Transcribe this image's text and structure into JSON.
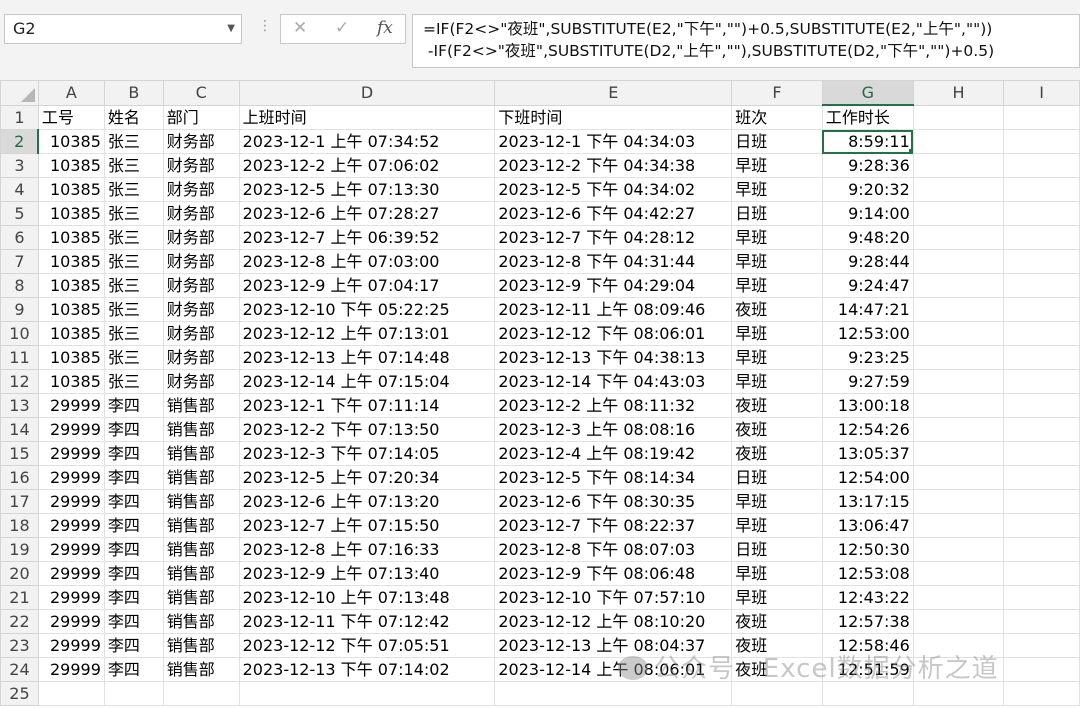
{
  "name_box": "G2",
  "formula_icons": [
    "close-icon",
    "check-icon",
    "fx-icon"
  ],
  "formula": "=IF(F2<>\"夜班\",SUBSTITUTE(E2,\"下午\",\"\")+0.5,SUBSTITUTE(E2,\"上午\",\"\"))\n -IF(F2<>\"夜班\",SUBSTITUTE(D2,\"上午\",\"\"),SUBSTITUTE(D2,\"下午\",\"\")+0.5)",
  "columns": [
    "A",
    "B",
    "C",
    "D",
    "E",
    "F",
    "G",
    "H",
    "I"
  ],
  "header_row": [
    "工号",
    "姓名",
    "部门",
    "上班时间",
    "下班时间",
    "班次",
    "工作时长"
  ],
  "rows": [
    [
      "10385",
      "张三",
      "财务部",
      "2023-12-1 上午 07:34:52",
      "2023-12-1 下午 04:34:03",
      "日班",
      "8:59:11"
    ],
    [
      "10385",
      "张三",
      "财务部",
      "2023-12-2 上午 07:06:02",
      "2023-12-2 下午 04:34:38",
      "早班",
      "9:28:36"
    ],
    [
      "10385",
      "张三",
      "财务部",
      "2023-12-5 上午 07:13:30",
      "2023-12-5 下午 04:34:02",
      "早班",
      "9:20:32"
    ],
    [
      "10385",
      "张三",
      "财务部",
      "2023-12-6 上午 07:28:27",
      "2023-12-6 下午 04:42:27",
      "日班",
      "9:14:00"
    ],
    [
      "10385",
      "张三",
      "财务部",
      "2023-12-7 上午 06:39:52",
      "2023-12-7 下午 04:28:12",
      "早班",
      "9:48:20"
    ],
    [
      "10385",
      "张三",
      "财务部",
      "2023-12-8 上午 07:03:00",
      "2023-12-8 下午 04:31:44",
      "早班",
      "9:28:44"
    ],
    [
      "10385",
      "张三",
      "财务部",
      "2023-12-9 上午 07:04:17",
      "2023-12-9 下午 04:29:04",
      "早班",
      "9:24:47"
    ],
    [
      "10385",
      "张三",
      "财务部",
      "2023-12-10 下午 05:22:25",
      "2023-12-11 上午 08:09:46",
      "夜班",
      "14:47:21"
    ],
    [
      "10385",
      "张三",
      "财务部",
      "2023-12-12 上午 07:13:01",
      "2023-12-12 下午 08:06:01",
      "早班",
      "12:53:00"
    ],
    [
      "10385",
      "张三",
      "财务部",
      "2023-12-13 上午 07:14:48",
      "2023-12-13 下午 04:38:13",
      "早班",
      "9:23:25"
    ],
    [
      "10385",
      "张三",
      "财务部",
      "2023-12-14 上午 07:15:04",
      "2023-12-14 下午 04:43:03",
      "早班",
      "9:27:59"
    ],
    [
      "29999",
      "李四",
      "销售部",
      "2023-12-1 下午 07:11:14",
      "2023-12-2 上午 08:11:32",
      "夜班",
      "13:00:18"
    ],
    [
      "29999",
      "李四",
      "销售部",
      "2023-12-2 下午 07:13:50",
      "2023-12-3 上午 08:08:16",
      "夜班",
      "12:54:26"
    ],
    [
      "29999",
      "李四",
      "销售部",
      "2023-12-3 下午 07:14:05",
      "2023-12-4 上午 08:19:42",
      "夜班",
      "13:05:37"
    ],
    [
      "29999",
      "李四",
      "销售部",
      "2023-12-5 上午 07:20:34",
      "2023-12-5 下午 08:14:34",
      "日班",
      "12:54:00"
    ],
    [
      "29999",
      "李四",
      "销售部",
      "2023-12-6 上午 07:13:20",
      "2023-12-6 下午 08:30:35",
      "早班",
      "13:17:15"
    ],
    [
      "29999",
      "李四",
      "销售部",
      "2023-12-7 上午 07:15:50",
      "2023-12-7 下午 08:22:37",
      "早班",
      "13:06:47"
    ],
    [
      "29999",
      "李四",
      "销售部",
      "2023-12-8 上午 07:16:33",
      "2023-12-8 下午 08:07:03",
      "日班",
      "12:50:30"
    ],
    [
      "29999",
      "李四",
      "销售部",
      "2023-12-9 上午 07:13:40",
      "2023-12-9 下午 08:06:48",
      "早班",
      "12:53:08"
    ],
    [
      "29999",
      "李四",
      "销售部",
      "2023-12-10 上午 07:13:48",
      "2023-12-10 下午 07:57:10",
      "早班",
      "12:43:22"
    ],
    [
      "29999",
      "李四",
      "销售部",
      "2023-12-11 下午 07:12:42",
      "2023-12-12 上午 08:10:20",
      "夜班",
      "12:57:38"
    ],
    [
      "29999",
      "李四",
      "销售部",
      "2023-12-12 下午 07:05:51",
      "2023-12-13 上午 08:04:37",
      "夜班",
      "12:58:46"
    ],
    [
      "29999",
      "李四",
      "销售部",
      "2023-12-13 下午 07:14:02",
      "2023-12-14 上午 08:06:01",
      "夜班",
      "12:51:59"
    ]
  ],
  "row_numbers": [
    "1",
    "2",
    "3",
    "4",
    "5",
    "6",
    "7",
    "8",
    "9",
    "10",
    "11",
    "12",
    "13",
    "14",
    "15",
    "16",
    "17",
    "18",
    "19",
    "20",
    "21",
    "22",
    "23",
    "24",
    "25"
  ],
  "selected_cell": "G2",
  "selection_color": "#217346",
  "watermark": "公众号 · Excel数据分析之道"
}
